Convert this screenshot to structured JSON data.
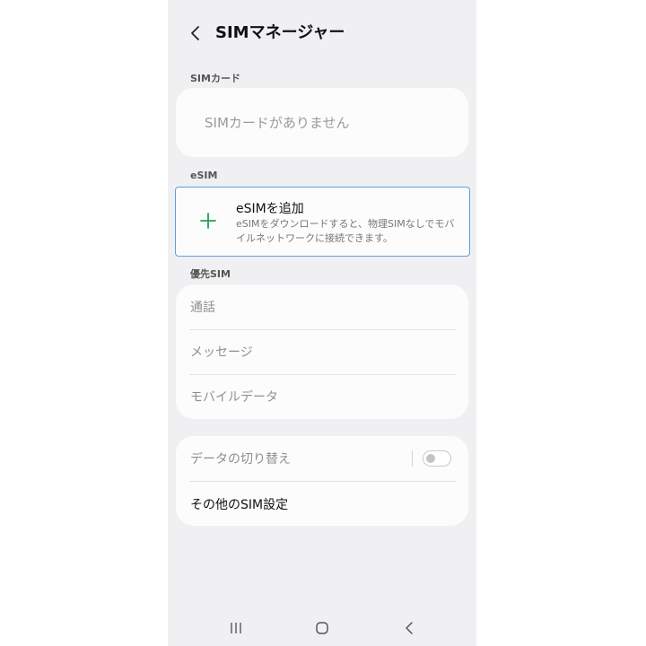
{
  "header": {
    "title": "SIMマネージャー",
    "back_icon": "chevron-left-icon"
  },
  "sim_card": {
    "section_label": "SIMカード",
    "empty_text": "SIMカードがありません"
  },
  "esim": {
    "section_label": "eSIM",
    "add_title": "eSIMを追加",
    "add_description": "eSIMをダウンロードすると、物理SIMなしでモバイルネットワークに接続できます。",
    "add_icon": "plus-icon",
    "accent_color": "#1e9e5a",
    "focus_border_color": "#5ea0da"
  },
  "preferred_sim": {
    "section_label": "優先SIM",
    "items": [
      {
        "label": "通話"
      },
      {
        "label": "メッセージ"
      },
      {
        "label": "モバイルデータ"
      }
    ]
  },
  "other": {
    "data_switch_label": "データの切り替え",
    "data_switch_on": false,
    "more_settings_label": "その他のSIM設定"
  },
  "navbar": {
    "recents_icon": "recents-icon",
    "home_icon": "home-icon",
    "back_icon": "back-icon"
  }
}
